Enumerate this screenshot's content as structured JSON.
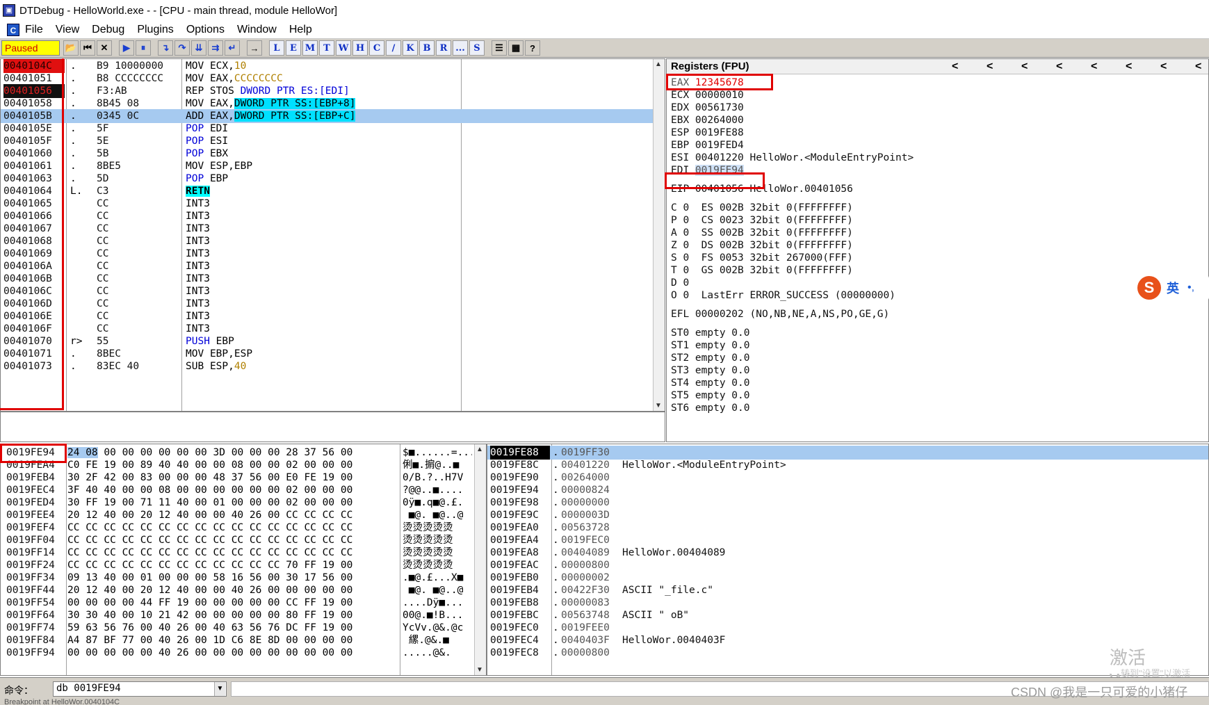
{
  "window": {
    "title": "DTDebug - HelloWorld.exe - - [CPU - main thread, module HelloWor]"
  },
  "menu": [
    "File",
    "View",
    "Debug",
    "Plugins",
    "Options",
    "Window",
    "Help"
  ],
  "toolbar": {
    "status": "Paused",
    "letters": [
      "L",
      "E",
      "M",
      "T",
      "W",
      "H",
      "C",
      "/",
      "K",
      "B",
      "R",
      "...",
      "S"
    ]
  },
  "disasm": {
    "rows": [
      {
        "addr": "0040104C",
        "mark": ".",
        "hex": "B9 10000000",
        "asm": "MOV ECX,10"
      },
      {
        "addr": "00401051",
        "mark": ".",
        "hex": "B8 CCCCCCCC",
        "asm": "MOV EAX,CCCCCCCC"
      },
      {
        "addr": "00401056",
        "mark": ".",
        "hex": "F3:AB",
        "asm": "REP STOS DWORD PTR ES:[EDI]"
      },
      {
        "addr": "00401058",
        "mark": ".",
        "hex": "8B45 08",
        "asm": "MOV EAX,DWORD PTR SS:[EBP+8]"
      },
      {
        "addr": "0040105B",
        "mark": ".",
        "hex": "0345 0C",
        "asm": "ADD EAX,DWORD PTR SS:[EBP+C]"
      },
      {
        "addr": "0040105E",
        "mark": ".",
        "hex": "5F",
        "asm": "POP EDI"
      },
      {
        "addr": "0040105F",
        "mark": ".",
        "hex": "5E",
        "asm": "POP ESI"
      },
      {
        "addr": "00401060",
        "mark": ".",
        "hex": "5B",
        "asm": "POP EBX"
      },
      {
        "addr": "00401061",
        "mark": ".",
        "hex": "8BE5",
        "asm": "MOV ESP,EBP"
      },
      {
        "addr": "00401063",
        "mark": ".",
        "hex": "5D",
        "asm": "POP EBP"
      },
      {
        "addr": "00401064",
        "mark": "L.",
        "hex": "C3",
        "asm": "RETN"
      },
      {
        "addr": "00401065",
        "mark": "",
        "hex": "CC",
        "asm": "INT3"
      },
      {
        "addr": "00401066",
        "mark": "",
        "hex": "CC",
        "asm": "INT3"
      },
      {
        "addr": "00401067",
        "mark": "",
        "hex": "CC",
        "asm": "INT3"
      },
      {
        "addr": "00401068",
        "mark": "",
        "hex": "CC",
        "asm": "INT3"
      },
      {
        "addr": "00401069",
        "mark": "",
        "hex": "CC",
        "asm": "INT3"
      },
      {
        "addr": "0040106A",
        "mark": "",
        "hex": "CC",
        "asm": "INT3"
      },
      {
        "addr": "0040106B",
        "mark": "",
        "hex": "CC",
        "asm": "INT3"
      },
      {
        "addr": "0040106C",
        "mark": "",
        "hex": "CC",
        "asm": "INT3"
      },
      {
        "addr": "0040106D",
        "mark": "",
        "hex": "CC",
        "asm": "INT3"
      },
      {
        "addr": "0040106E",
        "mark": "",
        "hex": "CC",
        "asm": "INT3"
      },
      {
        "addr": "0040106F",
        "mark": "",
        "hex": "CC",
        "asm": "INT3"
      },
      {
        "addr": "00401070",
        "mark": "r>",
        "hex": "55",
        "asm": "PUSH EBP"
      },
      {
        "addr": "00401071",
        "mark": ".",
        "hex": "8BEC",
        "asm": "MOV EBP,ESP"
      },
      {
        "addr": "00401073",
        "mark": ".",
        "hex": "83EC 40",
        "asm": "SUB ESP,40"
      }
    ]
  },
  "registers": {
    "header": "Registers (FPU)",
    "rows": [
      "EAX 12345678",
      "ECX 00000010",
      "EDX 00561730",
      "EBX 00264000",
      "ESP 0019FE88",
      "EBP 0019FED4",
      "ESI 00401220 HelloWor.<ModuleEntryPoint>",
      "EDI 0019FE94",
      "",
      "EIP 00401056 HelloWor.00401056",
      "",
      "C 0  ES 002B 32bit 0(FFFFFFFF)",
      "P 0  CS 0023 32bit 0(FFFFFFFF)",
      "A 0  SS 002B 32bit 0(FFFFFFFF)",
      "Z 0  DS 002B 32bit 0(FFFFFFFF)",
      "S 0  FS 0053 32bit 267000(FFF)",
      "T 0  GS 002B 32bit 0(FFFFFFFF)",
      "D 0",
      "O 0  LastErr ERROR_SUCCESS (00000000)",
      "",
      "EFL 00000202 (NO,NB,NE,A,NS,PO,GE,G)",
      "",
      "ST0 empty 0.0",
      "ST1 empty 0.0",
      "ST2 empty 0.0",
      "ST3 empty 0.0",
      "ST4 empty 0.0",
      "ST5 empty 0.0",
      "ST6 empty 0.0"
    ]
  },
  "ime": {
    "badge": "S",
    "lang": "英",
    "punct": "•,"
  },
  "dump": {
    "rows": [
      {
        "addr": "0019FE94",
        "hex": "24 08 00 00 00 00 00 00 3D 00 00 00 28 37 56 00",
        "ascii": "$■......=..."
      },
      {
        "addr": "0019FEA4",
        "hex": "C0 FE 19 00 89 40 40 00 00 08 00 00 02 00 00 00",
        "ascii": "俐■.掮@..■"
      },
      {
        "addr": "0019FEB4",
        "hex": "30 2F 42 00 83 00 00 00 48 37 56 00 E0 FE 19 00",
        "ascii": "0/B.?..H7V"
      },
      {
        "addr": "0019FEC4",
        "hex": "3F 40 40 00 00 08 00 00 00 00 00 00 02 00 00 00",
        "ascii": "?@@..■...."
      },
      {
        "addr": "0019FED4",
        "hex": "30 FF 19 00 71 11 40 00 01 00 00 00 02 00 00 00",
        "ascii": "0ÿ■.q■@.£."
      },
      {
        "addr": "0019FEE4",
        "hex": "20 12 40 00 20 12 40 00 00 40 26 00 CC CC CC CC",
        "ascii": " ■@. ■@..@"
      },
      {
        "addr": "0019FEF4",
        "hex": "CC CC CC CC CC CC CC CC CC CC CC CC CC CC CC CC",
        "ascii": "烫烫烫烫烫"
      },
      {
        "addr": "0019FF04",
        "hex": "CC CC CC CC CC CC CC CC CC CC CC CC CC CC CC CC",
        "ascii": "烫烫烫烫烫"
      },
      {
        "addr": "0019FF14",
        "hex": "CC CC CC CC CC CC CC CC CC CC CC CC CC CC CC CC",
        "ascii": "烫烫烫烫烫"
      },
      {
        "addr": "0019FF24",
        "hex": "CC CC CC CC CC CC CC CC CC CC CC CC 70 FF 19 00",
        "ascii": "烫烫烫烫烫"
      },
      {
        "addr": "0019FF34",
        "hex": "09 13 40 00 01 00 00 00 58 16 56 00 30 17 56 00",
        "ascii": ".■@.£...X■"
      },
      {
        "addr": "0019FF44",
        "hex": "20 12 40 00 20 12 40 00 00 40 26 00 00 00 00 00",
        "ascii": " ■@. ■@..@"
      },
      {
        "addr": "0019FF54",
        "hex": "00 00 00 00 44 FF 19 00 00 00 00 00 CC FF 19 00",
        "ascii": "....Dÿ■..."
      },
      {
        "addr": "0019FF64",
        "hex": "30 30 40 00 10 21 42 00 00 00 00 00 80 FF 19 00",
        "ascii": "00@.■!B..."
      },
      {
        "addr": "0019FF74",
        "hex": "59 63 56 76 00 40 26 00 40 63 56 76 DC FF 19 00",
        "ascii": "YcVv.@&.@c"
      },
      {
        "addr": "0019FF84",
        "hex": "A4 87 BF 77 00 40 26 00 1D C6 8E 8D 00 00 00 00",
        "ascii": " 縲.@&.■"
      },
      {
        "addr": "0019FF94",
        "hex": "00 00 00 00 00 40 26 00 00 00 00 00 00 00 00 00",
        "ascii": ".....@&."
      }
    ]
  },
  "stack": {
    "rows": [
      {
        "addr": "0019FE88",
        "val": "0019FF30",
        "comment": ""
      },
      {
        "addr": "0019FE8C",
        "val": "00401220",
        "comment": "HelloWor.<ModuleEntryPoint>"
      },
      {
        "addr": "0019FE90",
        "val": "00264000",
        "comment": ""
      },
      {
        "addr": "0019FE94",
        "val": "00000824",
        "comment": ""
      },
      {
        "addr": "0019FE98",
        "val": "00000000",
        "comment": ""
      },
      {
        "addr": "0019FE9C",
        "val": "0000003D",
        "comment": ""
      },
      {
        "addr": "0019FEA0",
        "val": "00563728",
        "comment": ""
      },
      {
        "addr": "0019FEA4",
        "val": "0019FEC0",
        "comment": ""
      },
      {
        "addr": "0019FEA8",
        "val": "00404089",
        "comment": "HelloWor.00404089"
      },
      {
        "addr": "0019FEAC",
        "val": "00000800",
        "comment": ""
      },
      {
        "addr": "0019FEB0",
        "val": "00000002",
        "comment": ""
      },
      {
        "addr": "0019FEB4",
        "val": "00422F30",
        "comment": "ASCII \"_file.c\""
      },
      {
        "addr": "0019FEB8",
        "val": "00000083",
        "comment": ""
      },
      {
        "addr": "0019FEBC",
        "val": "00563748",
        "comment": "ASCII \" oB\""
      },
      {
        "addr": "0019FEC0",
        "val": "0019FEE0",
        "comment": ""
      },
      {
        "addr": "0019FEC4",
        "val": "0040403F",
        "comment": "HelloWor.0040403F"
      },
      {
        "addr": "0019FEC8",
        "val": "00000800",
        "comment": ""
      }
    ]
  },
  "command": {
    "label": "命令：",
    "value": "db 0019FE94"
  },
  "bottom_status": "Breakpoint at HelloWor.0040104C",
  "watermark": {
    "line1": "激活 Windows",
    "line2": "转到\"设置\"以激活"
  },
  "csdn": "CSDN @我是一只可爱的小猪仔",
  "colors": {
    "breakpoint": "#e01010",
    "selection": "#a6caf0",
    "paused_bg": "#ffff00",
    "annotation_box": "#e00000"
  }
}
